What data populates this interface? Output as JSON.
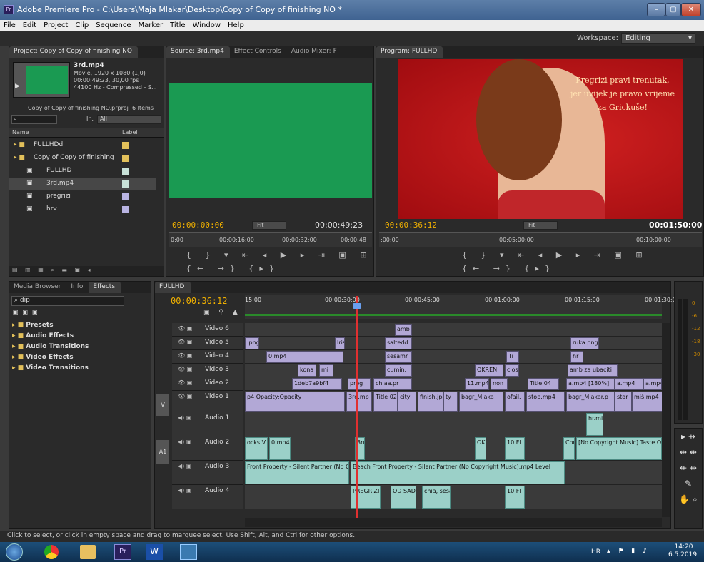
{
  "window": {
    "title": "Adobe Premiere Pro - C:\\Users\\Maja Mlakar\\Desktop\\Copy of Copy of finishing NO *",
    "app_icon": "Pr",
    "min": "–",
    "max": "▢",
    "close": "✕"
  },
  "menu": [
    "File",
    "Edit",
    "Project",
    "Clip",
    "Sequence",
    "Marker",
    "Title",
    "Window",
    "Help"
  ],
  "workspace": {
    "label": "Workspace:",
    "value": "Editing"
  },
  "project": {
    "tab": "Project: Copy of Copy of finishing NO",
    "clip_name": "3rd.mp4",
    "clip_info": [
      "Movie, 1920 x 1080 (1,0)",
      "00:00:49:23, 30,00 fps",
      "44100 Hz - Compressed - S..."
    ],
    "proj_file": "Copy of Copy of finishing NO.prproj",
    "items": "6 Items",
    "in_label": "In:",
    "in_value": "All",
    "col_name": "Name",
    "col_label": "Label",
    "rows": [
      {
        "name": "FULLHDd",
        "icon": "folder-icon",
        "color": "#e2c05a",
        "indent": 0
      },
      {
        "name": "Copy of Copy of finishing",
        "icon": "folder-icon",
        "color": "#e2c05a",
        "indent": 0
      },
      {
        "name": "FULLHD",
        "icon": "sequence-icon",
        "color": "#c9e2d8",
        "indent": 1
      },
      {
        "name": "3rd.mp4",
        "icon": "video-file-icon",
        "color": "#c9e2d8",
        "indent": 1
      },
      {
        "name": "pregrizi",
        "icon": "title-file-icon",
        "color": "#b9b4e2",
        "indent": 1
      },
      {
        "name": "hrv",
        "icon": "title-file-icon",
        "color": "#b9b4e2",
        "indent": 1
      }
    ]
  },
  "source": {
    "tabs": [
      "Source: 3rd.mp4",
      "Effect Controls",
      "Audio Mixer: F"
    ],
    "timecode": "00:00:00:00",
    "fit": "Fit",
    "duration": "00:00:49:23",
    "ruler": [
      "0:00",
      "00:00:16:00",
      "00:00:32:00",
      "00:00:48"
    ]
  },
  "program": {
    "tab": "Program: FULLHD",
    "timecode": "00:00:36:12",
    "fit": "Fit",
    "duration": "00:01:50:00",
    "ruler": [
      ":00:00",
      "00:05:00:00",
      "00:10:00:00"
    ],
    "overlay": [
      "Pregrizi pravi trenutak,",
      "jer uvijek je pravo vrijeme",
      "za Grickuše!"
    ]
  },
  "effects": {
    "tabs": [
      "Media Browser",
      "Info",
      "Effects"
    ],
    "search": "dip",
    "folders": [
      "Presets",
      "Audio Effects",
      "Audio Transitions",
      "Video Effects",
      "Video Transitions"
    ]
  },
  "timeline": {
    "tab": "FULLHD",
    "timecode": "00:00:36:12",
    "ruler": [
      "15:00",
      "00:00:30:00",
      "00:00:45:00",
      "00:01:00:00",
      "00:01:15:00",
      "00:01:30:00"
    ],
    "tracks": [
      "Video 6",
      "Video 5",
      "Video 4",
      "Video 3",
      "Video 2",
      "Video 1",
      "Audio 1",
      "Audio 2",
      "Audio 3",
      "Audio 4"
    ],
    "v_label": "V",
    "a_label": "A1",
    "clips_v6": [
      "amb"
    ],
    "clips_v5": [
      ".png",
      "Iris",
      "saltedd",
      "ruka.png"
    ],
    "clips_v4": [
      "0.mp4",
      "sesamr",
      "Ti",
      "hr"
    ],
    "clips_v3": [
      "kona",
      "mi",
      "cumin.",
      "OKREN",
      "clos",
      "amb za ubaciti"
    ],
    "clips_v2": [
      "1deb7a9bf4",
      "preg",
      "chiaa.pr",
      "11.mp4",
      "non",
      "Title 04",
      "a.mp4 [180%]",
      "a.mp4",
      "a.mp4"
    ],
    "clips_v1": [
      "p4 Opacity:Opacity",
      "3rd.mp",
      "Title 02",
      "city",
      "finish.jpg",
      "ty",
      "bagr_Mlaka",
      "ofail.",
      "stop.mp4",
      "bagr_Mlakar.p",
      "stor",
      "miš.mp4"
    ],
    "clips_a1": [
      "hr.mi"
    ],
    "clips_a2": [
      "ocks V",
      "0.mp4",
      "3rı",
      "OK",
      "10 Fl",
      "Con",
      "[No Copyright Music] Taste O"
    ],
    "clips_a3": [
      "Front Property - Silent Partner (No Cop",
      "Beach Front Property - Silent Partner (No Copyright Music).mp4  Level"
    ],
    "clips_a4": [
      "PREGRIZI",
      "OD SAD",
      "chia, sesa",
      "10 Fl"
    ]
  },
  "meters": [
    "0",
    "-6",
    "-12",
    "-18",
    "-30"
  ],
  "status": "Click to select, or click in empty space and drag to marquee select. Use Shift, Alt, and Ctrl for other options.",
  "tray": {
    "lang": "HR",
    "time": "14:20",
    "date": "6.5.2019."
  }
}
